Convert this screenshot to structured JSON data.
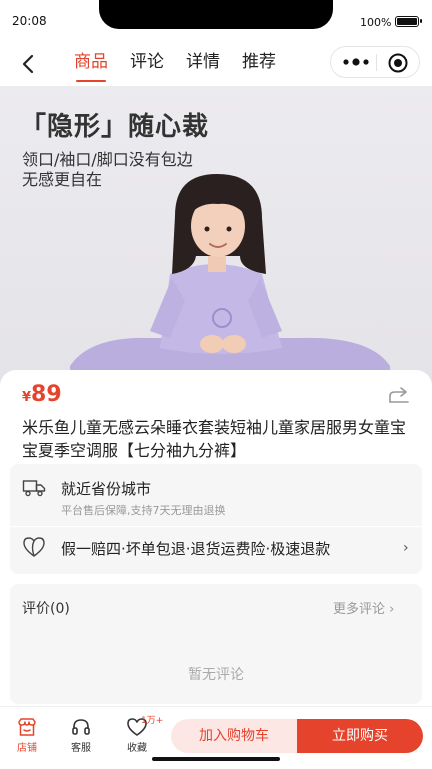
{
  "status_bar": {
    "time": "20:08",
    "battery": "100%"
  },
  "nav": {
    "tabs": [
      {
        "label": "商品",
        "active": true
      },
      {
        "label": "评论",
        "active": false
      },
      {
        "label": "详情",
        "active": false
      },
      {
        "label": "推荐",
        "active": false
      }
    ]
  },
  "hero": {
    "headline": "「隐形」随心裁",
    "line1": "领口/袖口/脚口没有包边",
    "line2": "无感更自在"
  },
  "product": {
    "currency": "¥",
    "price": "89",
    "title": "米乐鱼儿童无感云朵睡衣套装短袖儿童家居服男女童宝宝夏季空调服【七分袖九分裤】"
  },
  "services": {
    "shipping_title": "就近省份城市",
    "shipping_sub": "平台售后保障,支持7天无理由退换",
    "guarantee": "假一赔四·坏单包退·退货运费险·极速退款"
  },
  "reviews": {
    "label": "评价(0)",
    "more": "更多评论",
    "empty": "暂无评论"
  },
  "bottom_bar": {
    "store": "店铺",
    "service": "客服",
    "favorite": "收藏",
    "favorite_count": "1万+",
    "add_to_cart": "加入购物车",
    "buy_now": "立即购买"
  },
  "colors": {
    "accent": "#e5432b",
    "cart_bg": "#fde7e4"
  }
}
